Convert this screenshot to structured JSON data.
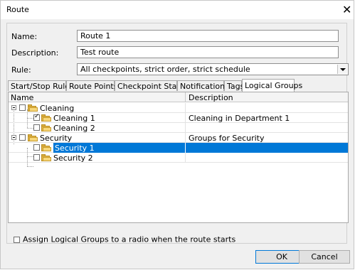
{
  "window": {
    "title": "Route",
    "close_glyph": "✕"
  },
  "form": {
    "name_label": "Name:",
    "name_value": "Route 1",
    "description_label": "Description:",
    "description_value": "Test route",
    "rule_label": "Rule:",
    "rule_value": "All checkpoints, strict order, strict schedule"
  },
  "tabs": [
    {
      "label": "Start/Stop Rules"
    },
    {
      "label": "Route Points"
    },
    {
      "label": "Checkpoint Statuses"
    },
    {
      "label": "Notifications"
    },
    {
      "label": "Tags"
    },
    {
      "label": "Logical Groups",
      "active": true
    }
  ],
  "grid": {
    "columns": [
      "Name",
      "Description"
    ],
    "rows": [
      {
        "name": "Cleaning",
        "description": "",
        "level": 0,
        "checked": false,
        "expanded": true
      },
      {
        "name": "Cleaning 1",
        "description": "Cleaning in Department 1",
        "level": 1,
        "checked": true
      },
      {
        "name": "Cleaning 2",
        "description": "",
        "level": 1,
        "checked": false
      },
      {
        "name": "Security",
        "description": "Groups for Security",
        "level": 0,
        "checked": false,
        "expanded": true
      },
      {
        "name": "Security 1",
        "description": "",
        "level": 1,
        "checked": false,
        "selected": true
      },
      {
        "name": "Security 2",
        "description": "",
        "level": 1,
        "checked": false
      }
    ]
  },
  "footer": {
    "assign_label": "Assign Logical Groups to a radio when the route starts",
    "ok_label": "OK",
    "cancel_label": "Cancel"
  },
  "colors": {
    "selection": "#0078d7",
    "folder": "#e6b94a"
  },
  "icons": [
    "folder-icon",
    "checkbox-icon",
    "expand-collapse-icon",
    "dropdown-arrow-icon",
    "close-icon"
  ]
}
